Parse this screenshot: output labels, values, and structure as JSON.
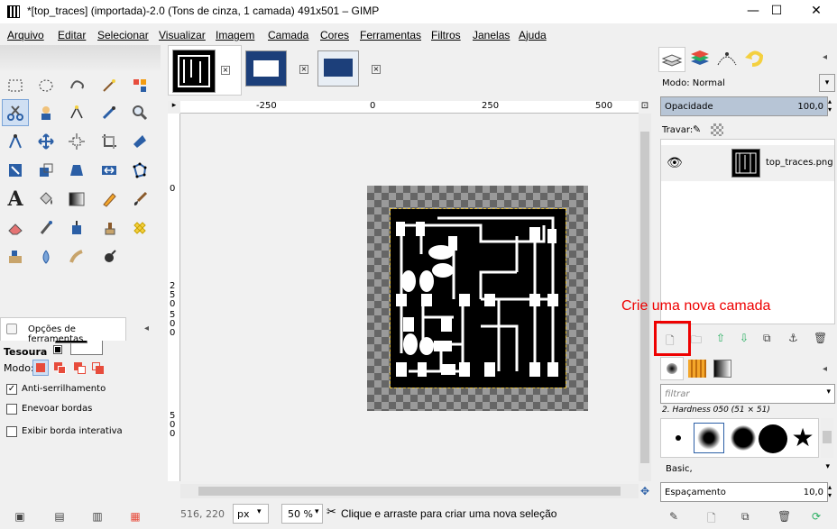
{
  "window": {
    "title": "*[top_traces] (importada)-2.0 (Tons de cinza, 1 camada) 491x501 – GIMP",
    "minimize": "—",
    "maximize": "☐",
    "close": "✕"
  },
  "menu": [
    "Arquivo",
    "Editar",
    "Selecionar",
    "Visualizar",
    "Imagem",
    "Camada",
    "Cores",
    "Ferramentas",
    "Filtros",
    "Janelas",
    "Ajuda"
  ],
  "toolbox": {
    "selected_tool": "scissors-select-tool"
  },
  "tool_options": {
    "tab_label": "Opções de ferramentas",
    "tool_name": "Tesoura",
    "mode_label": "Modo:",
    "checkboxes": [
      {
        "label": "Anti-serrilhamento",
        "checked": true
      },
      {
        "label": "Enevoar bordas",
        "checked": false
      },
      {
        "label": "Exibir borda interativa",
        "checked": false
      }
    ]
  },
  "rulers": {
    "h_labels": [
      "-250",
      "0",
      "250",
      "500"
    ],
    "v_labels": [
      "0",
      "2",
      "5",
      "0",
      "5",
      "0",
      "0",
      "5",
      "0",
      "0"
    ]
  },
  "statusbar": {
    "coords": "516, 220",
    "unit": "px",
    "zoom": "50 %",
    "message": "Clique e arraste para criar uma nova seleção"
  },
  "layers": {
    "mode_label": "Modo: Normal",
    "opacity_label": "Opacidade",
    "opacity_value": "100,0",
    "lock_label": "Travar:",
    "layer_name": "top_traces.png"
  },
  "brushes": {
    "filter_placeholder": "filtrar",
    "brush_title": "2. Hardness 050 (51 × 51)",
    "preset": "Basic,",
    "spacing_label": "Espaçamento",
    "spacing_value": "10,0"
  },
  "annotation": {
    "text": "Crie uma nova camada"
  },
  "colors": {
    "accent": "#2b5fa6",
    "annotation_red": "#e00000",
    "opacity_bar": "#b7c5d6"
  }
}
